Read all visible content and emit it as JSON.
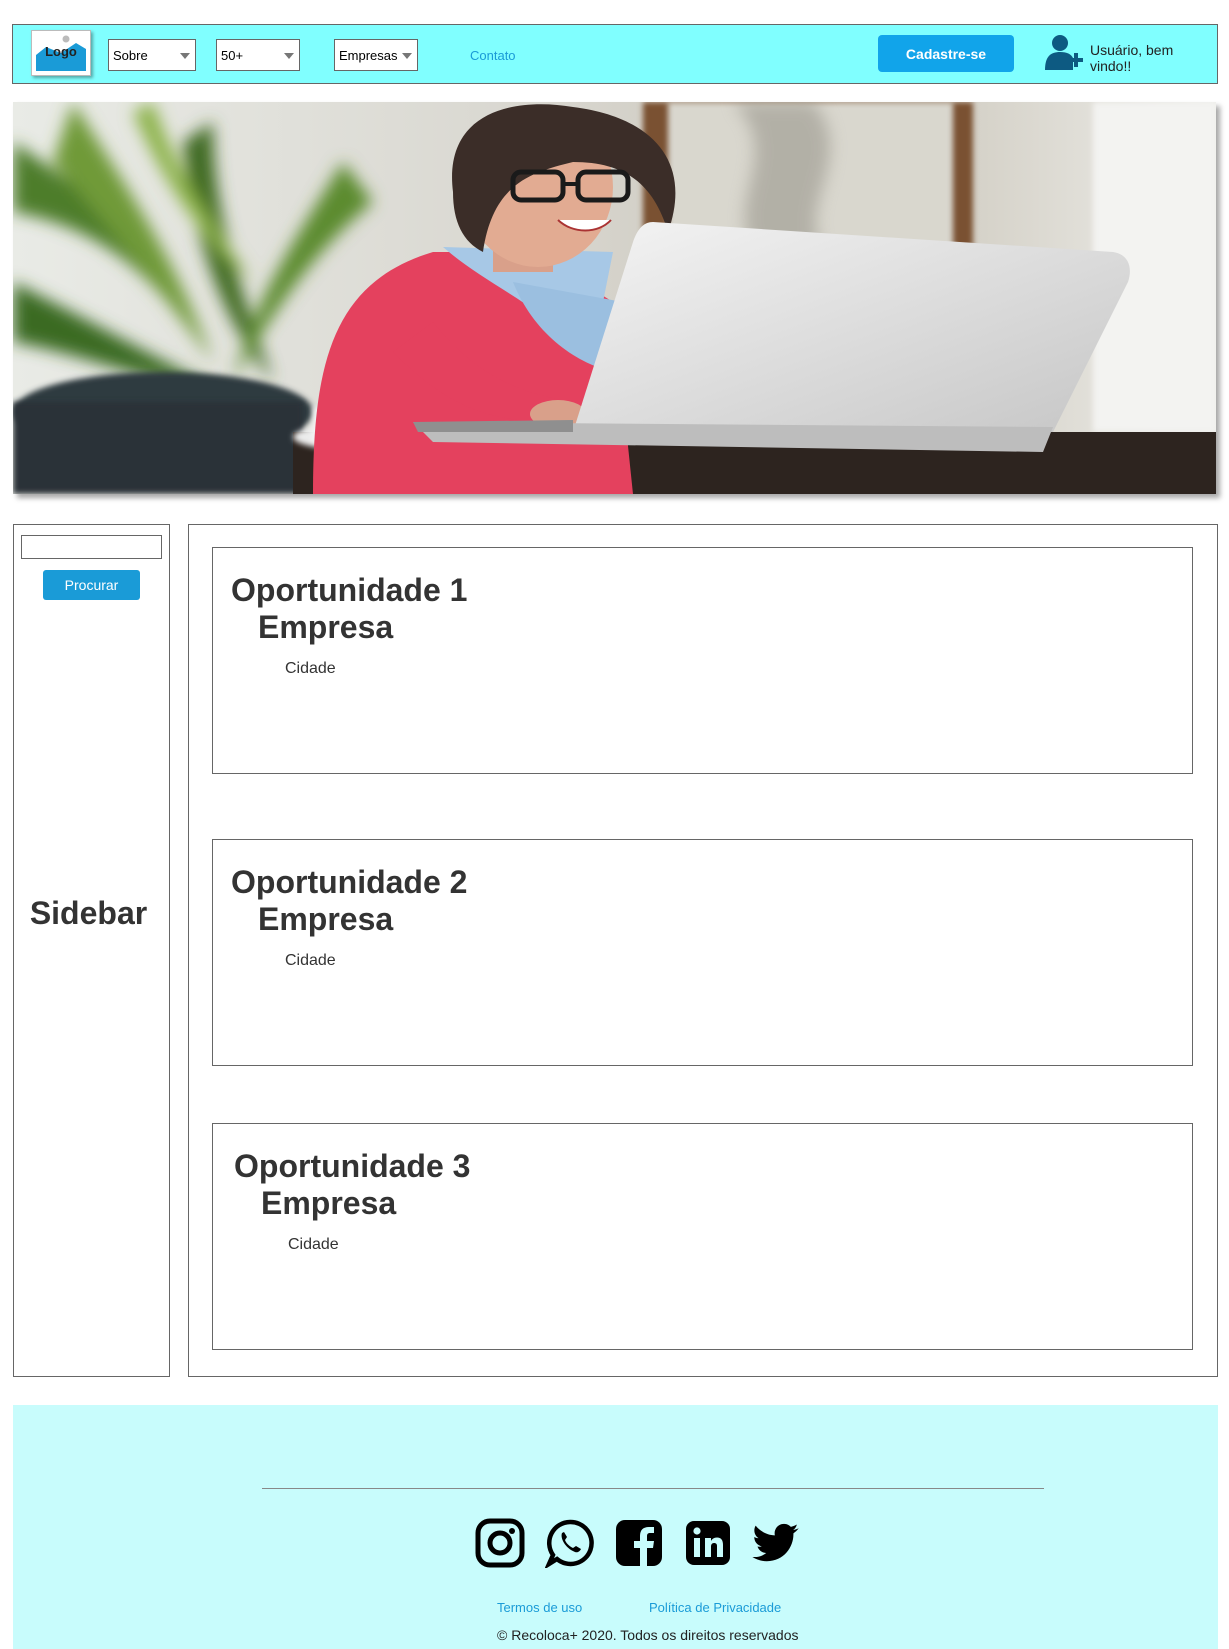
{
  "header": {
    "logo_label": "Logo",
    "menus": [
      {
        "label": "Sobre"
      },
      {
        "label": "50+"
      },
      {
        "label": "Empresas"
      }
    ],
    "contact_link": "Contato",
    "signup_button": "Cadastre-se",
    "user_greeting": "Usuário, bem vindo!!",
    "bg_color": "#80ffff",
    "accent_color": "#11a4ea"
  },
  "hero": {
    "image_icon": "photo-woman-laptop"
  },
  "sidebar": {
    "search_placeholder": "",
    "search_button": "Procurar",
    "title": "Sidebar"
  },
  "opportunities": [
    {
      "title": "Oportunidade 1",
      "company": "Empresa",
      "city": "Cidade"
    },
    {
      "title": "Oportunidade 2",
      "company": "Empresa",
      "city": "Cidade"
    },
    {
      "title": "Oportunidade 3",
      "company": "Empresa",
      "city": "Cidade"
    }
  ],
  "footer": {
    "social_icons": [
      "instagram-icon",
      "whatsapp-icon",
      "facebook-icon",
      "linkedin-icon",
      "twitter-icon"
    ],
    "links": [
      "Termos de uso",
      "Política de Privacidade"
    ],
    "copyright": "© Recoloca+ 2020. Todos os direitos reservados",
    "bg_color": "#c8fcfc"
  }
}
